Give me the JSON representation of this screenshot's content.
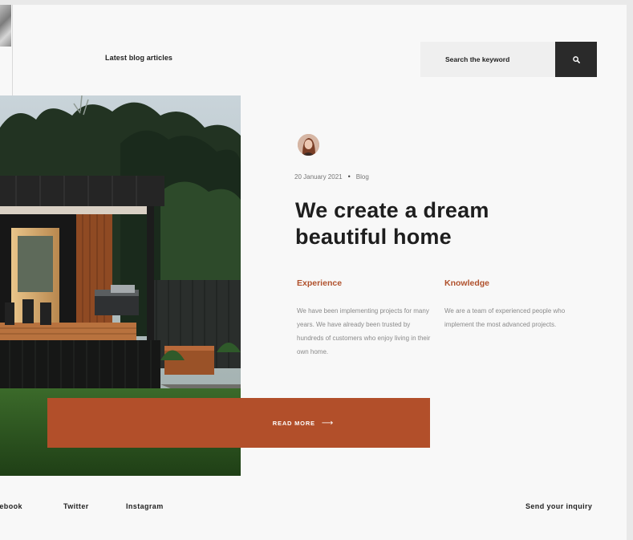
{
  "header": {
    "blog_link": "Latest blog articles",
    "search": {
      "placeholder": "Search the keyword"
    }
  },
  "article": {
    "date": "20 January 2021",
    "separator": "•",
    "category": "Blog",
    "title": "We create a dream beautiful home",
    "cta_label": "READ MORE",
    "cta_arrow": "⟶",
    "columns": [
      {
        "title": "Experience",
        "text": "We have been implementing projects for many years. We have already been trusted by hundreds of customers who enjoy living in their own home."
      },
      {
        "title": "Knowledge",
        "text": "We are a team of experienced people who implement the most advanced projects."
      }
    ]
  },
  "footer": {
    "links": [
      "cebook",
      "Twitter",
      "Instagram"
    ],
    "inquiry": "Send your inquiry"
  },
  "colors": {
    "accent": "#b24f2a",
    "dark": "#2a2a2a",
    "background": "#f8f8f8"
  },
  "icons": [
    "search-icon",
    "arrow-right-icon",
    "author-avatar"
  ]
}
